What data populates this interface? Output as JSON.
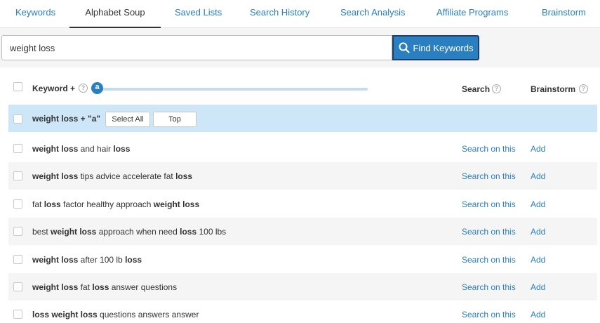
{
  "tabs": [
    {
      "label": "Keywords",
      "active": false
    },
    {
      "label": "Alphabet Soup",
      "active": true
    },
    {
      "label": "Saved Lists",
      "active": false
    },
    {
      "label": "Search History",
      "active": false
    },
    {
      "label": "Search Analysis",
      "active": false
    },
    {
      "label": "Affiliate Programs",
      "active": false
    },
    {
      "label": "Brainstorm",
      "active": false
    }
  ],
  "search": {
    "value": "weight loss",
    "button_label": "Find Keywords",
    "button_icon": "search-icon"
  },
  "table": {
    "header": {
      "keyword_label": "Keyword +",
      "slider_letter": "a",
      "search_label": "Search",
      "brainstorm_label": "Brainstorm",
      "help_icon": "?"
    },
    "group": {
      "label": "weight loss + \"a\"",
      "select_all_label": "Select All",
      "top_label": "Top"
    },
    "rows": [
      {
        "segments": [
          {
            "text": "weight loss",
            "bold": true
          },
          {
            "text": " and hair ",
            "bold": false
          },
          {
            "text": "loss",
            "bold": true
          }
        ],
        "search_link": "Search on this",
        "add_link": "Add"
      },
      {
        "segments": [
          {
            "text": "weight loss",
            "bold": true
          },
          {
            "text": " tips advice accelerate fat ",
            "bold": false
          },
          {
            "text": "loss",
            "bold": true
          }
        ],
        "search_link": "Search on this",
        "add_link": "Add"
      },
      {
        "segments": [
          {
            "text": "fat ",
            "bold": false
          },
          {
            "text": "loss",
            "bold": true
          },
          {
            "text": " factor healthy approach ",
            "bold": false
          },
          {
            "text": "weight loss",
            "bold": true
          }
        ],
        "search_link": "Search on this",
        "add_link": "Add"
      },
      {
        "segments": [
          {
            "text": "best ",
            "bold": false
          },
          {
            "text": "weight loss",
            "bold": true
          },
          {
            "text": " approach when need ",
            "bold": false
          },
          {
            "text": "loss",
            "bold": true
          },
          {
            "text": " 100 lbs",
            "bold": false
          }
        ],
        "search_link": "Search on this",
        "add_link": "Add"
      },
      {
        "segments": [
          {
            "text": "weight loss",
            "bold": true
          },
          {
            "text": " after 100 lb ",
            "bold": false
          },
          {
            "text": "loss",
            "bold": true
          }
        ],
        "search_link": "Search on this",
        "add_link": "Add"
      },
      {
        "segments": [
          {
            "text": "weight loss",
            "bold": true
          },
          {
            "text": " fat ",
            "bold": false
          },
          {
            "text": "loss",
            "bold": true
          },
          {
            "text": " answer questions",
            "bold": false
          }
        ],
        "search_link": "Search on this",
        "add_link": "Add"
      },
      {
        "segments": [
          {
            "text": "loss weight loss",
            "bold": true
          },
          {
            "text": " questions answers answer",
            "bold": false
          }
        ],
        "search_link": "Search on this",
        "add_link": "Add"
      }
    ]
  },
  "colors": {
    "accent": "#2a7fc1",
    "selected_row": "#cde6f8",
    "alt_row": "#f5f5f5"
  }
}
